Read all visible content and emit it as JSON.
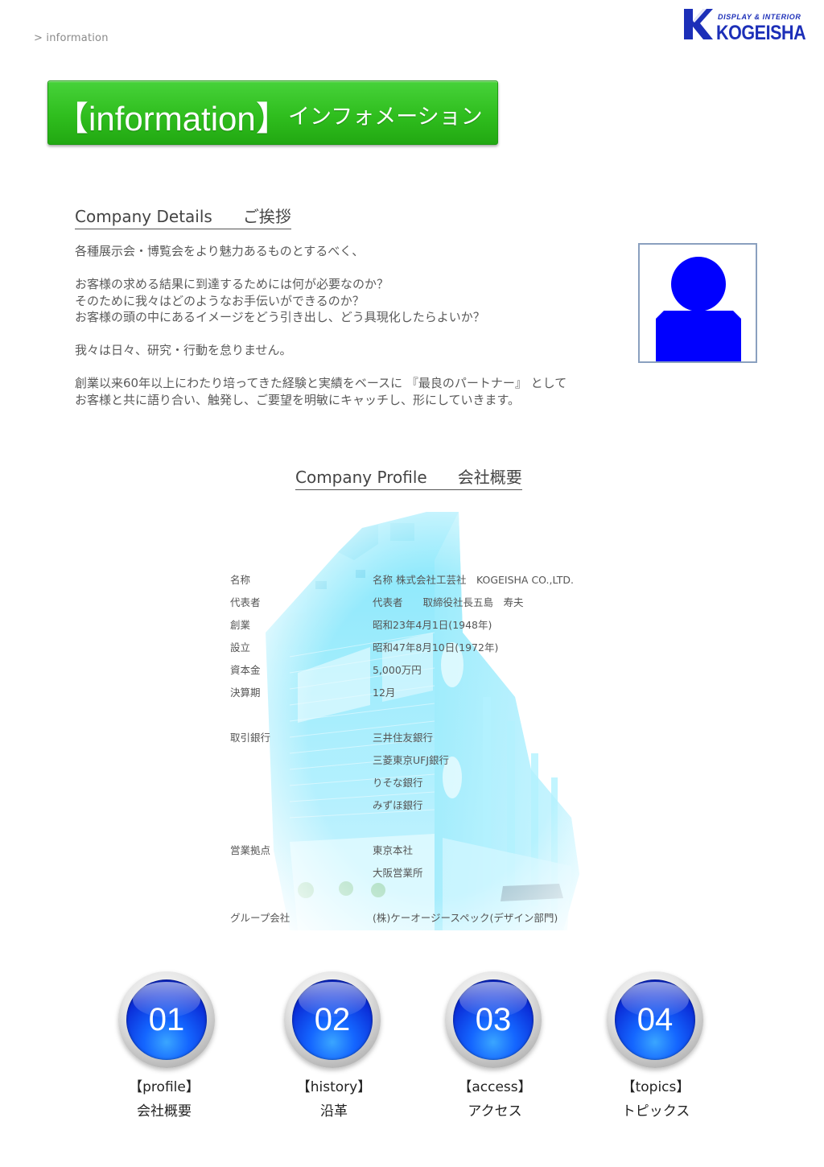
{
  "breadcrumb": "> information",
  "logo": {
    "tagline": "DISPLAY & INTERIOR",
    "name": "KOGEISHA"
  },
  "banner": {
    "en": "【information】",
    "jp": "インフォメーション"
  },
  "details": {
    "heading_en": "Company Details",
    "heading_jp": "ご挨拶",
    "lines": [
      "各種展示会・博覧会をより魅力あるものとするべく、",
      "",
      "お客様の求める結果に到達するためには何が必要なのか？",
      "そのために我々はどのようなお手伝いができるのか？",
      "お客様の頭の中にあるイメージをどう引き出し、どう具現化したらよいか？",
      "",
      "我々は日々、研究・行動を怠りません。",
      "",
      "創業以来60年以上にわたり培ってきた経験と実績をベースに 『最良のパートナー』 として",
      "お客様と共に語り合い、触発し、ご要望を明敏にキャッチし、形にしていきます。"
    ]
  },
  "profile": {
    "heading_en": "Company Profile",
    "heading_jp": "会社概要",
    "rows": [
      {
        "label": "名称",
        "value": "名称  株式会社工芸社　KOGEISHA CO.,LTD."
      },
      {
        "label": "代表者",
        "value": "代表者　　取締役社長五島　寿夫"
      },
      {
        "label": "創業",
        "value": "昭和23年4月1日(1948年)"
      },
      {
        "label": "設立",
        "value": "昭和47年8月10日(1972年)"
      },
      {
        "label": "資本金",
        "value": "5,000万円"
      },
      {
        "label": "決算期",
        "value": "12月"
      },
      {
        "label": "取引銀行",
        "value": "三井住友銀行"
      },
      {
        "label": "",
        "value": "三菱東京UFJ銀行"
      },
      {
        "label": "",
        "value": "りそな銀行"
      },
      {
        "label": "",
        "value": "みずほ銀行"
      },
      {
        "label": "営業拠点",
        "value": "東京本社"
      },
      {
        "label": "",
        "value": "大阪営業所"
      },
      {
        "label": "グループ会社",
        "value": "(株)ケーオージースペック(デザイン部門)"
      }
    ]
  },
  "nav": [
    {
      "num": "01",
      "en": "【profile】",
      "jp": "会社概要"
    },
    {
      "num": "02",
      "en": "【history】",
      "jp": "沿革"
    },
    {
      "num": "03",
      "en": "【access】",
      "jp": "アクセス"
    },
    {
      "num": "04",
      "en": "【topics】",
      "jp": "トピックス"
    }
  ],
  "colors": {
    "banner": "#2fbe1e",
    "circle": "#1466ff",
    "avatar": "#0000ff",
    "logo": "#1c2fb8"
  }
}
